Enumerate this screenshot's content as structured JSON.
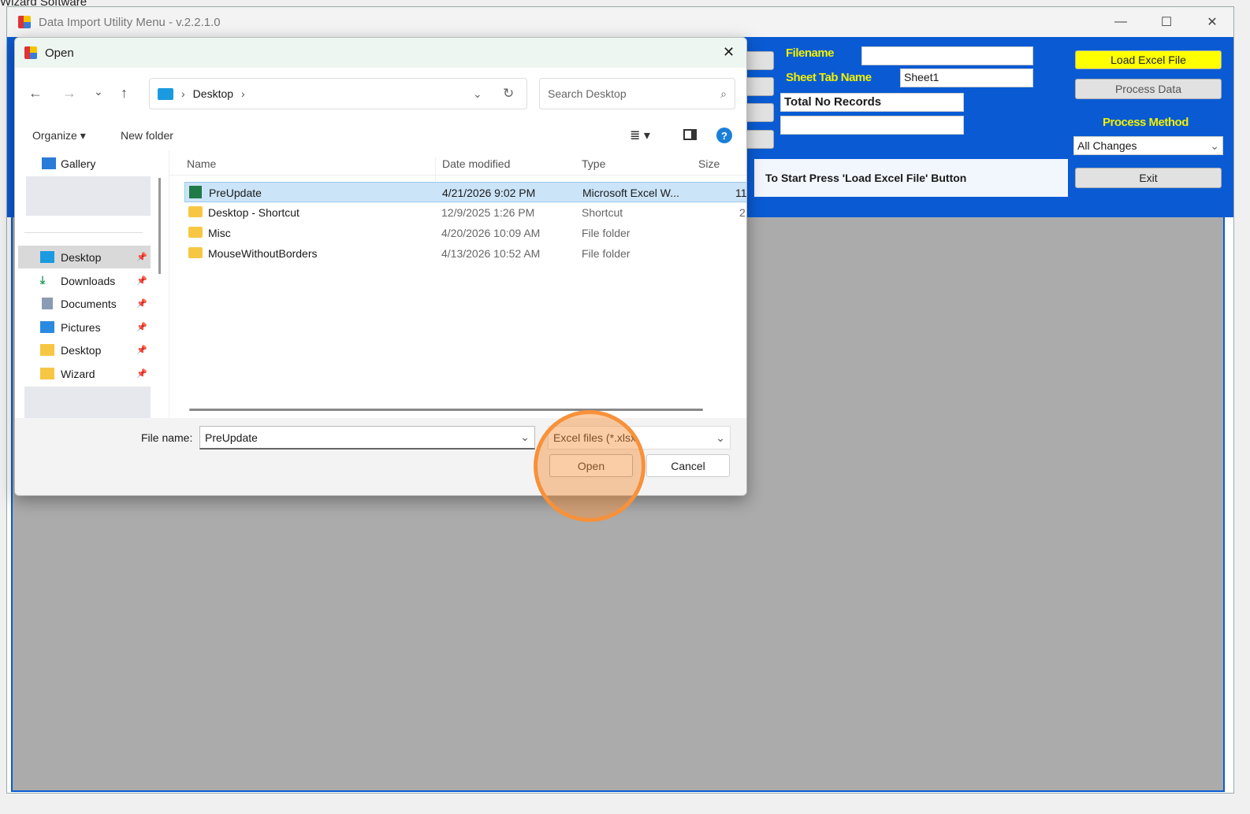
{
  "background_window_label": "Wizard Software",
  "app": {
    "title": "Data Import Utility Menu - v.2.2.1.0",
    "filename_label": "Filename",
    "filename_value": "",
    "sheet_tab_label": "Sheet Tab Name",
    "sheet_tab_value": "Sheet1",
    "total_records_label": "Total No Records",
    "total_records_value": "",
    "status_message": "To Start Press 'Load Excel File' Button",
    "load_button": "Load Excel File",
    "process_button": "Process Data",
    "process_method_label": "Process Method",
    "process_method_value": "All Changes",
    "exit_button": "Exit"
  },
  "dialog": {
    "title": "Open",
    "breadcrumb": "Desktop",
    "search_placeholder": "Search Desktop",
    "organize": "Organize",
    "new_folder": "New folder",
    "sidebar": [
      {
        "label": "Gallery"
      },
      {
        "label": "Desktop"
      },
      {
        "label": "Downloads"
      },
      {
        "label": "Documents"
      },
      {
        "label": "Pictures"
      },
      {
        "label": "Desktop"
      },
      {
        "label": "Wizard"
      }
    ],
    "columns": [
      "Name",
      "Date modified",
      "Type",
      "Size"
    ],
    "files": [
      {
        "name": "PreUpdate",
        "date": "4/21/2026 9:02 PM",
        "type": "Microsoft Excel W...",
        "size": "11"
      },
      {
        "name": "Desktop - Shortcut",
        "date": "12/9/2025 1:26 PM",
        "type": "Shortcut",
        "size": "2"
      },
      {
        "name": "Misc",
        "date": "4/20/2026 10:09 AM",
        "type": "File folder",
        "size": ""
      },
      {
        "name": "MouseWithoutBorders",
        "date": "4/13/2026 10:52 AM",
        "type": "File folder",
        "size": ""
      }
    ],
    "file_name_label": "File name:",
    "file_name_value": "PreUpdate",
    "file_type": "Excel files (*.xlsx",
    "open_button": "Open",
    "cancel_button": "Cancel"
  },
  "colors": {
    "app_blue": "#0a5bd3",
    "label_yellow": "#f0f000",
    "load_button": "#ffff00",
    "highlight": "#f7913a"
  }
}
